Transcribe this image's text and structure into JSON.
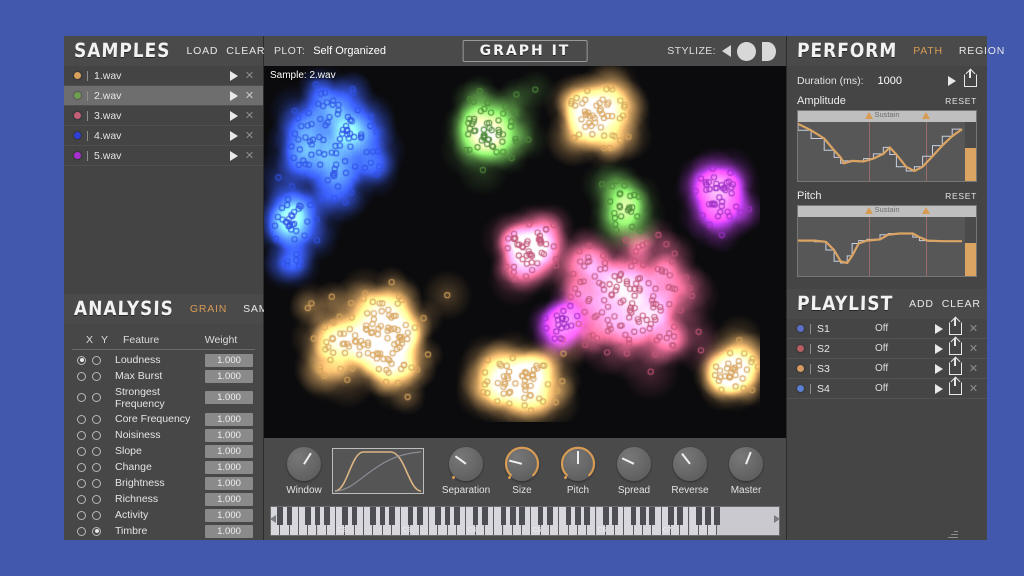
{
  "theme": {
    "desktop_bg": "#4158ad",
    "app_bg": "#3a3a3a",
    "accent": "#d79b54",
    "text": "#e8e8e8"
  },
  "samples_panel": {
    "title": "SAMPLES",
    "load_label": "LOAD",
    "clear_label": "CLEAR",
    "items": [
      {
        "name": "1.wav",
        "color": "#d9a05b",
        "selected": false
      },
      {
        "name": "2.wav",
        "color": "#6f9e4e",
        "selected": true
      },
      {
        "name": "3.wav",
        "color": "#c45f77",
        "selected": false
      },
      {
        "name": "4.wav",
        "color": "#2d3fd4",
        "selected": false
      },
      {
        "name": "5.wav",
        "color": "#a930d0",
        "selected": false
      }
    ]
  },
  "analysis_panel": {
    "title": "ANALYSIS",
    "grain_label": "GRAIN",
    "sample_label": "SAMPLE",
    "active_mode": "GRAIN",
    "columns": {
      "x": "X",
      "y": "Y",
      "feature": "Feature",
      "weight": "Weight"
    },
    "features": [
      {
        "label": "Loudness",
        "x": true,
        "y": false,
        "weight": "1.000"
      },
      {
        "label": "Max Burst",
        "x": false,
        "y": false,
        "weight": "1.000"
      },
      {
        "label": "Strongest Frequency",
        "x": false,
        "y": false,
        "weight": "1.000"
      },
      {
        "label": "Core Frequency",
        "x": false,
        "y": false,
        "weight": "1.000"
      },
      {
        "label": "Noisiness",
        "x": false,
        "y": false,
        "weight": "1.000"
      },
      {
        "label": "Slope",
        "x": false,
        "y": false,
        "weight": "1.000"
      },
      {
        "label": "Change",
        "x": false,
        "y": false,
        "weight": "1.000"
      },
      {
        "label": "Brightness",
        "x": false,
        "y": false,
        "weight": "1.000"
      },
      {
        "label": "Richness",
        "x": false,
        "y": false,
        "weight": "1.000"
      },
      {
        "label": "Activity",
        "x": false,
        "y": false,
        "weight": "1.000"
      },
      {
        "label": "Timbre",
        "x": false,
        "y": true,
        "weight": "1.000"
      }
    ]
  },
  "topbar": {
    "plot_label": "PLOT:",
    "plot_value": "Self Organized",
    "logo": "GRAPH IT",
    "stylize_label": "STYLIZE:",
    "stylize_shapes": [
      "triangle-shape-icon",
      "circle-shape-icon",
      "pie-shape-icon"
    ]
  },
  "plot": {
    "sample_overlay": "Sample: 2.wav",
    "clusters": [
      {
        "color": "#2f52e8",
        "cx": 0.14,
        "cy": 0.22,
        "rx": 0.13,
        "ry": 0.22,
        "n": 90
      },
      {
        "color": "#2f52e8",
        "cx": 0.06,
        "cy": 0.45,
        "rx": 0.06,
        "ry": 0.16,
        "n": 35
      },
      {
        "color": "#4f8a3a",
        "cx": 0.46,
        "cy": 0.18,
        "rx": 0.1,
        "ry": 0.15,
        "n": 55
      },
      {
        "color": "#4f8a3a",
        "cx": 0.72,
        "cy": 0.4,
        "rx": 0.06,
        "ry": 0.1,
        "n": 25
      },
      {
        "color": "#d8a45c",
        "cx": 0.67,
        "cy": 0.14,
        "rx": 0.1,
        "ry": 0.12,
        "n": 50
      },
      {
        "color": "#d8a45c",
        "cx": 0.22,
        "cy": 0.76,
        "rx": 0.17,
        "ry": 0.2,
        "n": 110
      },
      {
        "color": "#d8a45c",
        "cx": 0.52,
        "cy": 0.88,
        "rx": 0.12,
        "ry": 0.12,
        "n": 55
      },
      {
        "color": "#c4567a",
        "cx": 0.74,
        "cy": 0.66,
        "rx": 0.17,
        "ry": 0.26,
        "n": 130
      },
      {
        "color": "#c4567a",
        "cx": 0.54,
        "cy": 0.52,
        "rx": 0.09,
        "ry": 0.13,
        "n": 45
      },
      {
        "color": "#a02fc8",
        "cx": 0.92,
        "cy": 0.36,
        "rx": 0.07,
        "ry": 0.13,
        "n": 40
      },
      {
        "color": "#a02fc8",
        "cx": 0.6,
        "cy": 0.72,
        "rx": 0.05,
        "ry": 0.07,
        "n": 18
      },
      {
        "color": "#d8a45c",
        "cx": 0.95,
        "cy": 0.86,
        "rx": 0.07,
        "ry": 0.1,
        "n": 30
      }
    ]
  },
  "grain_controls": {
    "window_label": "Window",
    "window_value": 0.62,
    "knobs": [
      {
        "label": "Separation",
        "value": 0.3,
        "arc": false,
        "led": true
      },
      {
        "label": "Size",
        "value": 0.22,
        "arc": true,
        "led": true
      },
      {
        "label": "Pitch",
        "value": 0.5,
        "arc": true,
        "led": true
      },
      {
        "label": "Spread",
        "value": 0.26,
        "arc": false,
        "led": false
      },
      {
        "label": "Reverse",
        "value": 0.36,
        "arc": false,
        "led": false
      },
      {
        "label": "Master",
        "value": 0.58,
        "arc": false,
        "led": false
      }
    ]
  },
  "keyboard": {
    "octave_labels": [
      "C2",
      "C3",
      "C4",
      "C5",
      "C6",
      "C7"
    ],
    "scroll_left_icon": "chevron-left-icon",
    "scroll_right_icon": "chevron-right-icon"
  },
  "perform_panel": {
    "title": "PERFORM",
    "path_label": "PATH",
    "region_label": "REGION",
    "active_mode": "PATH",
    "duration_label": "Duration (ms):",
    "duration_value": "1000",
    "play_icon": "play-icon",
    "export_icon": "export-icon",
    "envelopes": [
      {
        "name": "Amplitude",
        "reset_label": "RESET",
        "sustain_label": "Sustain",
        "sustain_start": 0.4,
        "sustain_end": 0.72,
        "curve": [
          [
            0.0,
            0.97
          ],
          [
            0.08,
            0.86
          ],
          [
            0.16,
            0.72
          ],
          [
            0.22,
            0.52
          ],
          [
            0.26,
            0.4
          ],
          [
            0.28,
            0.3
          ],
          [
            0.33,
            0.34
          ],
          [
            0.4,
            0.33
          ],
          [
            0.46,
            0.38
          ],
          [
            0.52,
            0.46
          ],
          [
            0.56,
            0.57
          ],
          [
            0.6,
            0.45
          ],
          [
            0.66,
            0.24
          ],
          [
            0.71,
            0.17
          ],
          [
            0.76,
            0.24
          ],
          [
            0.82,
            0.42
          ],
          [
            0.88,
            0.6
          ],
          [
            0.94,
            0.76
          ],
          [
            1.0,
            0.88
          ]
        ],
        "tail_level": 0.56
      },
      {
        "name": "Pitch",
        "reset_label": "RESET",
        "sustain_label": "Sustain",
        "sustain_start": 0.4,
        "sustain_end": 0.72,
        "curve": [
          [
            0.0,
            0.6
          ],
          [
            0.1,
            0.6
          ],
          [
            0.17,
            0.58
          ],
          [
            0.22,
            0.44
          ],
          [
            0.26,
            0.25
          ],
          [
            0.3,
            0.22
          ],
          [
            0.33,
            0.34
          ],
          [
            0.37,
            0.55
          ],
          [
            0.42,
            0.6
          ],
          [
            0.5,
            0.62
          ],
          [
            0.55,
            0.7
          ],
          [
            0.62,
            0.72
          ],
          [
            0.7,
            0.72
          ],
          [
            0.74,
            0.66
          ],
          [
            0.79,
            0.6
          ],
          [
            0.88,
            0.59
          ],
          [
            1.0,
            0.59
          ]
        ],
        "tail_level": 0.56
      }
    ]
  },
  "playlist_panel": {
    "title": "PLAYLIST",
    "add_label": "ADD",
    "clear_label": "CLEAR",
    "items": [
      {
        "name": "S1",
        "state": "Off",
        "color": "#5b6fc9",
        "selected": true
      },
      {
        "name": "S2",
        "state": "Off",
        "color": "#b85d63",
        "selected": false
      },
      {
        "name": "S3",
        "state": "Off",
        "color": "#d79b63",
        "selected": false
      },
      {
        "name": "S4",
        "state": "Off",
        "color": "#5b7fd4",
        "selected": false
      }
    ]
  }
}
